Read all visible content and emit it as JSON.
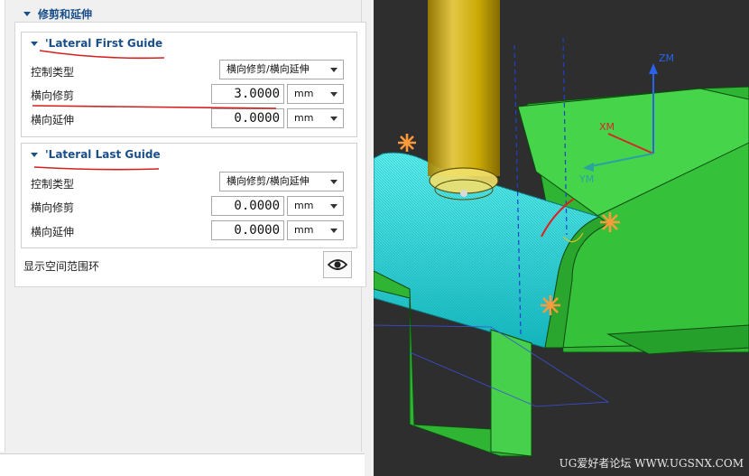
{
  "trim_section": {
    "title": "修剪和延伸"
  },
  "first_guide": {
    "title": "'Lateral First Guide",
    "control_type_label": "控制类型",
    "control_type_value": "横向修剪/横向延伸",
    "trim_label": "横向修剪",
    "trim_value": "3.0000",
    "trim_unit": "mm",
    "extend_label": "横向延伸",
    "extend_value": "0.0000",
    "extend_unit": "mm"
  },
  "last_guide": {
    "title": "'Lateral Last Guide",
    "control_type_label": "控制类型",
    "control_type_value": "横向修剪/横向延伸",
    "trim_label": "横向修剪",
    "trim_value": "0.0000",
    "trim_unit": "mm",
    "extend_label": "横向延伸",
    "extend_value": "0.0000",
    "extend_unit": "mm"
  },
  "show_range_ring_label": "显示空间范围环",
  "viewport": {
    "axis_zm": "ZM",
    "axis_xm": "XM",
    "axis_ym": "YM",
    "watermark": "UG爱好者论坛 WWW.UGSNX.COM"
  },
  "colors": {
    "header_blue": "#1a4f8a",
    "annotation_red": "#d42020",
    "part_green": "#35c23a",
    "surface_cyan": "#22d4d4",
    "tool_yellow": "#d8b400",
    "viewport_bg": "#2e2e2e"
  },
  "icons": {
    "collapse": "triangle-down",
    "show_ring": "eye-icon",
    "dropdown": "chevron-down"
  }
}
